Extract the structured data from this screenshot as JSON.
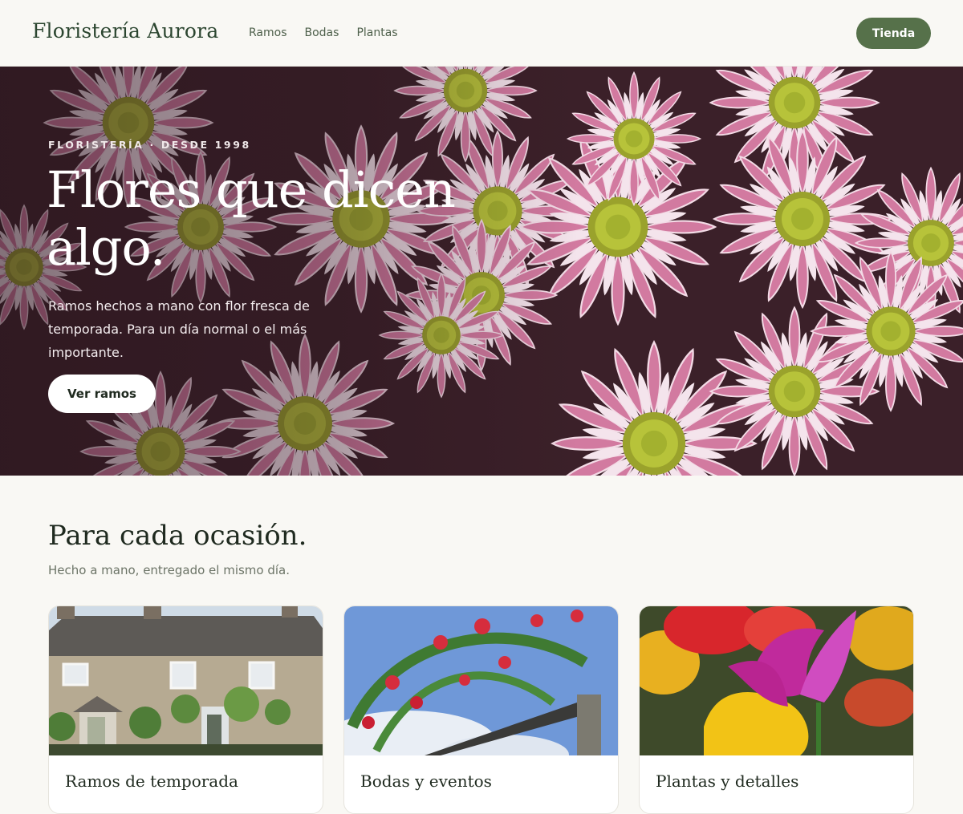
{
  "header": {
    "brand": "Floristería Aurora",
    "nav": [
      "Ramos",
      "Bodas",
      "Plantas"
    ],
    "shop_label": "Tienda"
  },
  "hero": {
    "eyebrow": "FLORISTERÍA · DESDE 1998",
    "title": "Flores que dicen algo.",
    "text": "Ramos hechos a mano con flor fresca de temporada. Para un día normal o el más importante.",
    "button_label": "Ver ramos",
    "image": "pink-chrysanthemums-photo"
  },
  "occasions": {
    "title": "Para cada ocasión.",
    "subtitle": "Hecho a mano, entregado el mismo día.",
    "cards": [
      {
        "title": "Ramos de temporada",
        "image": "stone-cottage-photo"
      },
      {
        "title": "Bodas y eventos",
        "image": "red-roses-arch-photo"
      },
      {
        "title": "Plantas y detalles",
        "image": "tulips-photo"
      }
    ]
  },
  "colors": {
    "accent": "#56714a",
    "background": "#f9f8f4",
    "brand_text": "#2c4630"
  }
}
